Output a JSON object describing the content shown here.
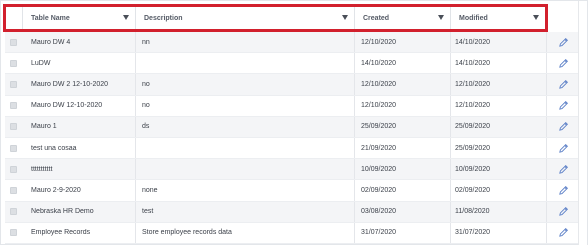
{
  "header": {
    "columns": [
      "Table Name",
      "Description",
      "Created",
      "Modified"
    ]
  },
  "rows": [
    {
      "name": "Mauro DW 4",
      "description": "nn",
      "created": "12/10/2020",
      "modified": "14/10/2020"
    },
    {
      "name": "LuDW",
      "description": "",
      "created": "14/10/2020",
      "modified": "14/10/2020"
    },
    {
      "name": "Mauro DW 2 12-10-2020",
      "description": "no",
      "created": "12/10/2020",
      "modified": "12/10/2020"
    },
    {
      "name": "Mauro DW 12-10-2020",
      "description": "no",
      "created": "12/10/2020",
      "modified": "12/10/2020"
    },
    {
      "name": "Mauro 1",
      "description": "ds",
      "created": "25/09/2020",
      "modified": "25/09/2020"
    },
    {
      "name": "test una cosaa",
      "description": "",
      "created": "21/09/2020",
      "modified": "25/09/2020"
    },
    {
      "name": "ttttttttttt",
      "description": "",
      "created": "10/09/2020",
      "modified": "10/09/2020"
    },
    {
      "name": "Mauro 2-9-2020",
      "description": "none",
      "created": "02/09/2020",
      "modified": "02/09/2020"
    },
    {
      "name": "Nebraska HR Demo",
      "description": "test",
      "created": "03/08/2020",
      "modified": "11/08/2020"
    },
    {
      "name": "Employee Records",
      "description": "Store employee records data",
      "created": "31/07/2020",
      "modified": "31/07/2020"
    }
  ],
  "icons": {
    "edit": "pencil-icon",
    "sort": "caret-down-icon"
  },
  "colors": {
    "highlight_border": "#d2202d",
    "edit_icon": "#5b7fc7",
    "row_alt": "#f4f5f7"
  }
}
